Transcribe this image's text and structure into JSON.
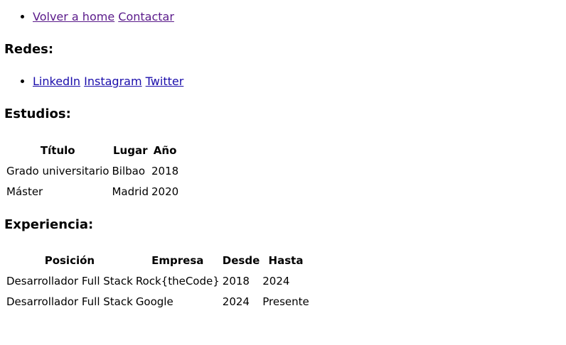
{
  "nav": {
    "links": [
      {
        "label": "Volver a home"
      },
      {
        "label": "Contactar"
      }
    ]
  },
  "redes": {
    "heading": "Redes:",
    "links": [
      {
        "label": "LinkedIn"
      },
      {
        "label": "Instagram"
      },
      {
        "label": "Twitter"
      }
    ]
  },
  "estudios": {
    "heading": "Estudios:",
    "headers": [
      "Título",
      "Lugar",
      "Año"
    ],
    "rows": [
      [
        "Grado universitario",
        "Bilbao",
        "2018"
      ],
      [
        "Máster",
        "Madrid",
        "2020"
      ]
    ]
  },
  "experiencia": {
    "heading": "Experiencia:",
    "headers": [
      "Posición",
      "Empresa",
      "Desde",
      "Hasta"
    ],
    "rows": [
      [
        "Desarrollador Full Stack",
        "Rock{theCode}",
        "2018",
        "2024"
      ],
      [
        "Desarrollador Full Stack",
        "Google",
        "2024",
        "Presente"
      ]
    ]
  },
  "colors": {
    "link": "#1a0dab",
    "visited_link": "#5a1a8a",
    "text": "#000000",
    "background": "#ffffff"
  }
}
